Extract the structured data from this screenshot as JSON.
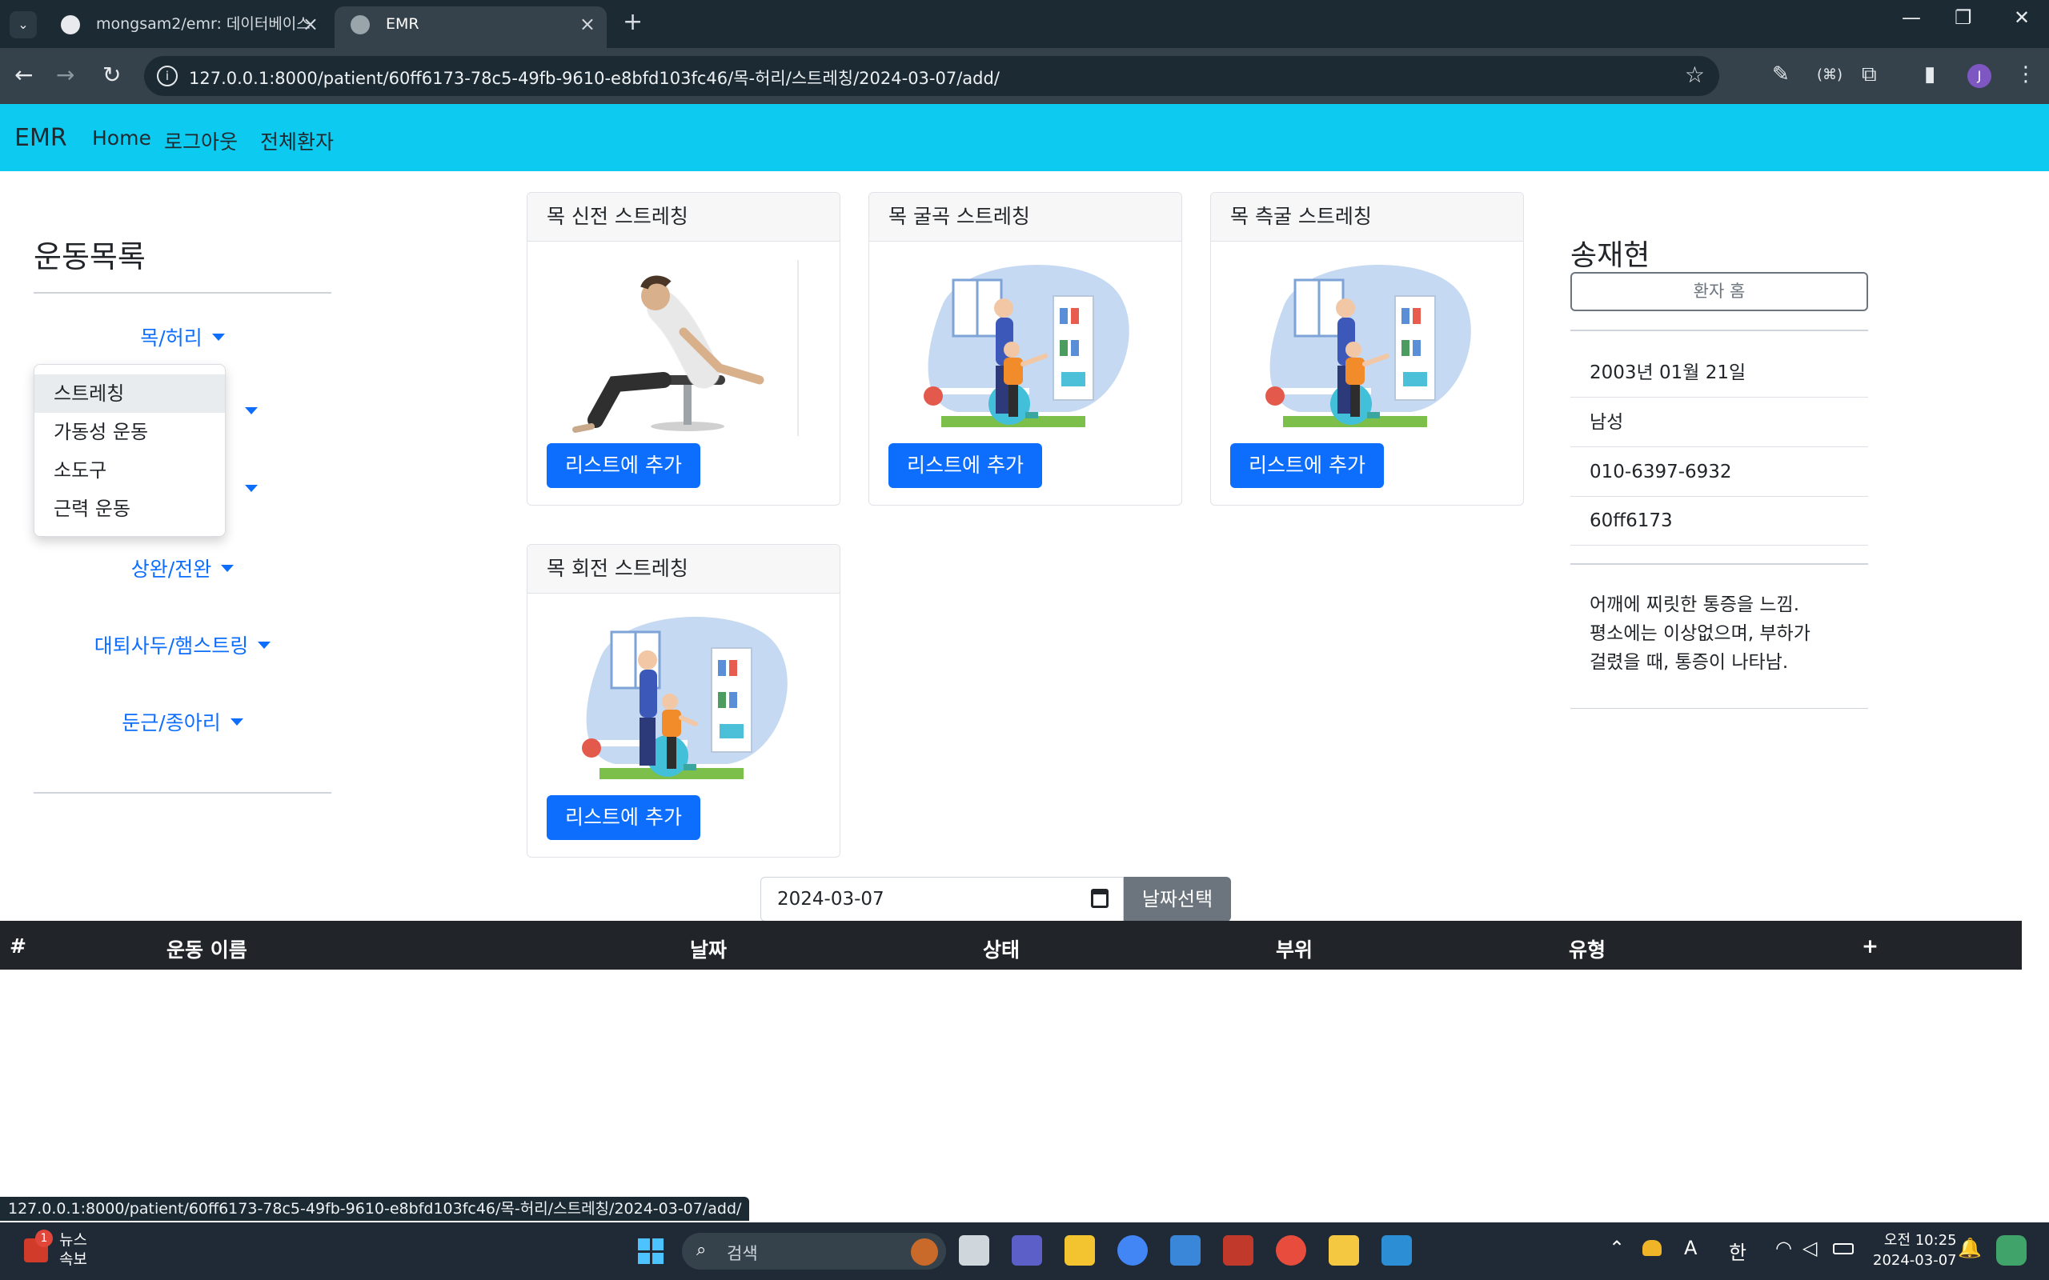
{
  "browser": {
    "tabs": [
      {
        "title": "mongsam2/emr: 데이터베이스"
      },
      {
        "title": "EMR"
      }
    ],
    "url": "127.0.0.1:8000/patient/60ff6173-78c5-49fb-9610-e8bfd103fc46/목-허리/스트레칭/2024-03-07/add/",
    "profile_initial": "J",
    "status_link": "127.0.0.1:8000/patient/60ff6173-78c5-49fb-9610-e8bfd103fc46/목-허리/스트레칭/2024-03-07/add/"
  },
  "navbar": {
    "brand": "EMR",
    "links": [
      "Home",
      "로그아웃",
      "전체환자"
    ]
  },
  "sidebar": {
    "title": "운동목록",
    "categories": [
      "목/허리",
      "상완/전완",
      "대퇴사두/햄스트링",
      "둔근/종아리"
    ],
    "open_menu": {
      "items": [
        "스트레칭",
        "가동성 운동",
        "소도구",
        "근력 운동"
      ],
      "active_index": 0
    }
  },
  "exercises": [
    {
      "name": "목 신전 스트레칭",
      "button": "리스트에 추가"
    },
    {
      "name": "목 굴곡 스트레칭",
      "button": "리스트에 추가"
    },
    {
      "name": "목 측굴 스트레칭",
      "button": "리스트에 추가"
    },
    {
      "name": "목 회전 스트레칭",
      "button": "리스트에 추가"
    }
  ],
  "patient": {
    "name": "송재현",
    "home_button": "환자 홈",
    "birth": "2003년 01월 21일",
    "gender": "남성",
    "phone": "010-6397-6932",
    "id": "60ff6173",
    "note_lines": [
      "어깨에 찌릿한 통증을 느낌.",
      "평소에는 이상없으며, 부하가",
      "걸렸을 때, 통증이 나타남."
    ]
  },
  "date_picker": {
    "value": "2024-03-07",
    "button": "날짜선택"
  },
  "table": {
    "headers": [
      "#",
      "운동 이름",
      "날짜",
      "상태",
      "부위",
      "유형",
      "+"
    ]
  },
  "taskbar": {
    "news_label": "뉴스",
    "news_sub": "속보",
    "news_badge": "1",
    "search_placeholder": "검색",
    "ime_a": "A",
    "ime_han": "한",
    "time": "오전 10:25",
    "date": "2024-03-07"
  },
  "colors": {
    "navbar": "#0dcaf0",
    "primary": "#0d6efd",
    "secondary": "#6c757d",
    "table_head": "#212529"
  }
}
